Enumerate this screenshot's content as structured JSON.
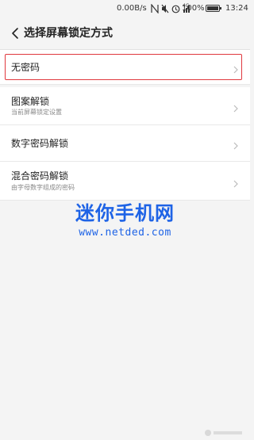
{
  "status": {
    "speed": "0.00B/s",
    "signal_label": "4G",
    "battery": "100%",
    "time": "13:24"
  },
  "header": {
    "title": "选择屏幕锁定方式"
  },
  "options": [
    {
      "label": "无密码",
      "sub": "",
      "selected": true
    },
    {
      "label": "图案解锁",
      "sub": "当前屏幕锁定设置",
      "selected": false
    },
    {
      "label": "数字密码解锁",
      "sub": "",
      "selected": false
    },
    {
      "label": "混合密码解锁",
      "sub": "由字母数字组成的密码",
      "selected": false
    }
  ],
  "watermark": {
    "title": "迷你手机网",
    "url": "www.netded.com"
  },
  "colors": {
    "selected_border": "#e0383e",
    "watermark": "#1e63e6"
  }
}
